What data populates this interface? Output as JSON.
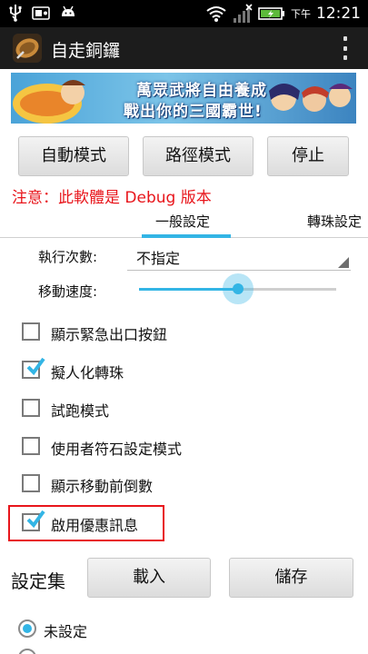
{
  "status_bar": {
    "ampm": "下午",
    "time": "12:21",
    "icons": [
      "usb-icon",
      "media-icon",
      "android-icon",
      "wifi-icon",
      "signal-icon",
      "battery-charging-icon"
    ]
  },
  "app": {
    "title": "自走銅鑼"
  },
  "banner": {
    "line1": "萬眾武將自由養成",
    "line2": "戰出你的三國霸世!"
  },
  "buttons": {
    "auto_mode": "自動模式",
    "path_mode": "路徑模式",
    "stop": "停止"
  },
  "warning": "注意：此軟體是 Debug 版本",
  "tabs": [
    {
      "label": "一般設定",
      "selected": true
    },
    {
      "label": "轉珠設定",
      "selected": false
    }
  ],
  "settings": {
    "exec_count_label": "執行次數:",
    "exec_count_value": "不指定",
    "move_speed_label": "移動速度:",
    "move_speed_value": 0.5
  },
  "checkboxes": [
    {
      "label": "顯示緊急出口按鈕",
      "checked": false
    },
    {
      "label": "擬人化轉珠",
      "checked": true
    },
    {
      "label": "試跑模式",
      "checked": false
    },
    {
      "label": "使用者符石設定模式",
      "checked": false
    },
    {
      "label": "顯示移動前倒數",
      "checked": false
    },
    {
      "label": "啟用優惠訊息",
      "checked": true
    }
  ],
  "preset": {
    "title": "設定集",
    "load": "載入",
    "save": "儲存"
  },
  "radio": {
    "label": "未設定",
    "selected": true
  },
  "colors": {
    "accent": "#33b5e5",
    "warning": "#e8151b",
    "actionbar": "#1c1c1c"
  }
}
